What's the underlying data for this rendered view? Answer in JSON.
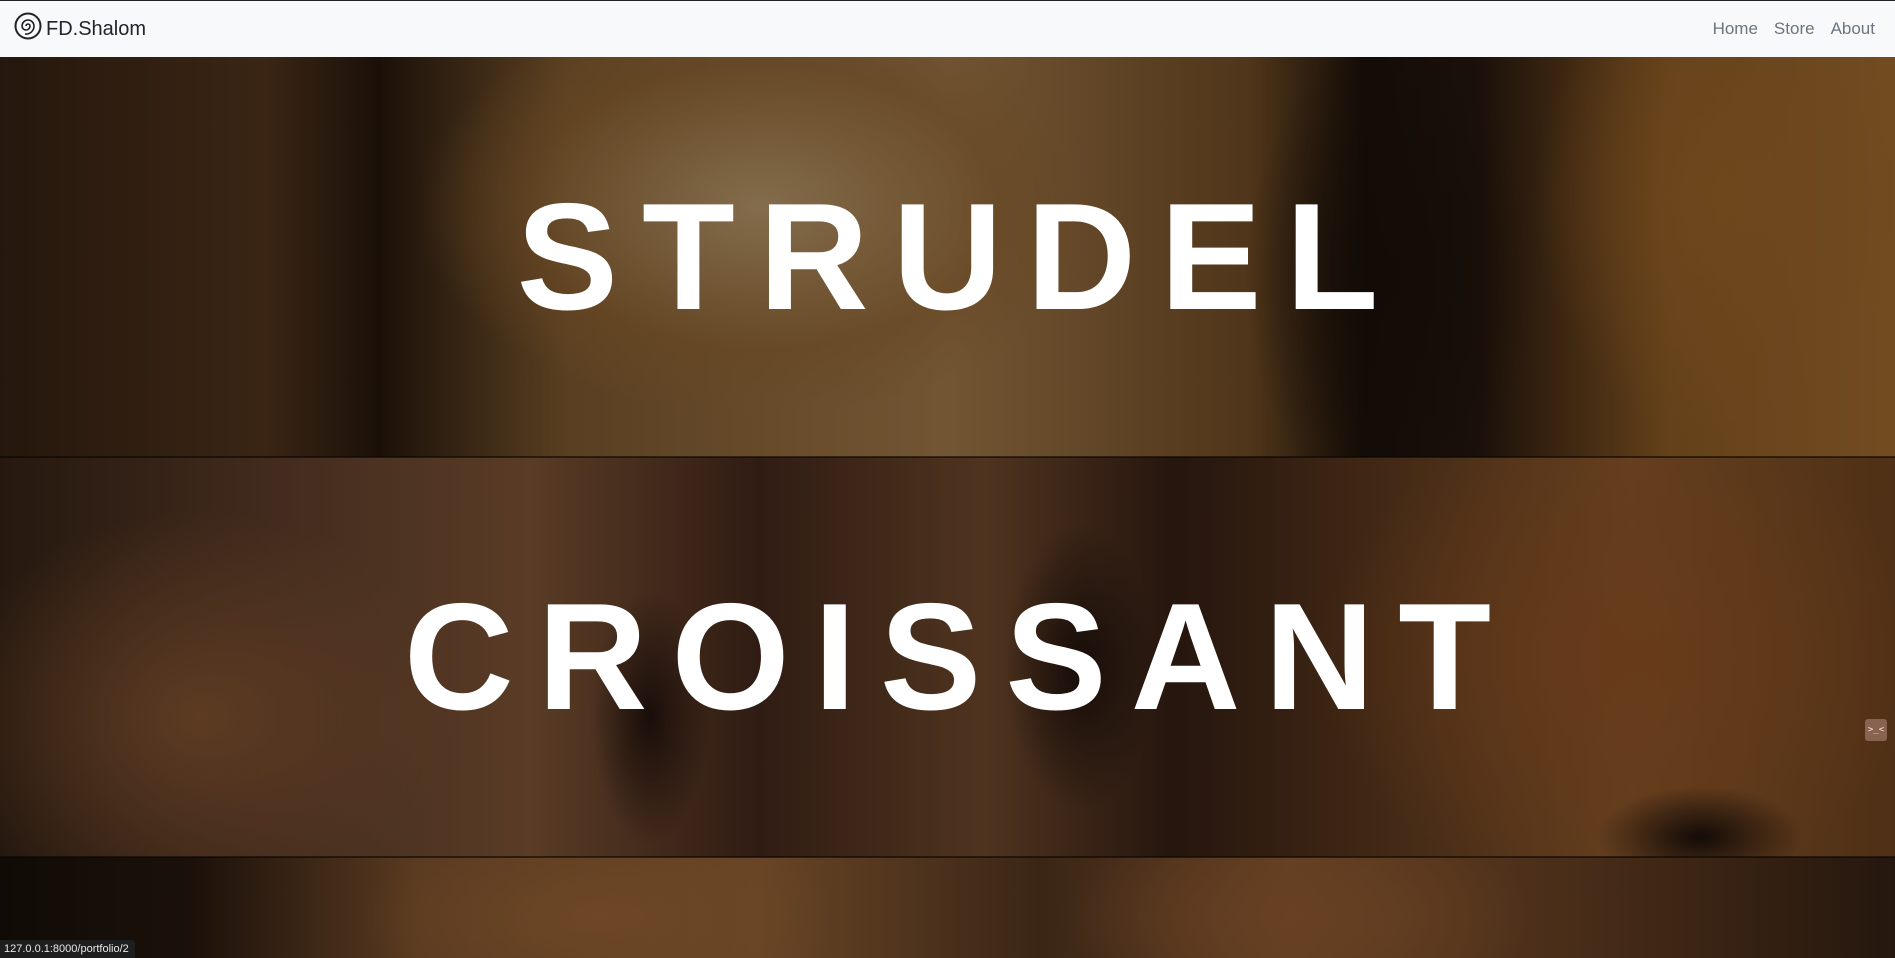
{
  "navbar": {
    "brand": "FD.Shalom",
    "brand_icon": "spiral-logo-icon",
    "links": [
      "Home",
      "Store",
      "About"
    ]
  },
  "sections": [
    {
      "title": "STRUDEL"
    },
    {
      "title": "CROISSANT"
    },
    {
      "title": ""
    }
  ],
  "status_bar": {
    "url": "127.0.0.1:8000/portfolio/2"
  },
  "side_handle": {
    "icon": "terminal-icon",
    "label": ">_<"
  },
  "colors": {
    "navbar_bg": "#f8f9fa",
    "nav_link": "#6c757d",
    "title_text": "#ffffff"
  }
}
